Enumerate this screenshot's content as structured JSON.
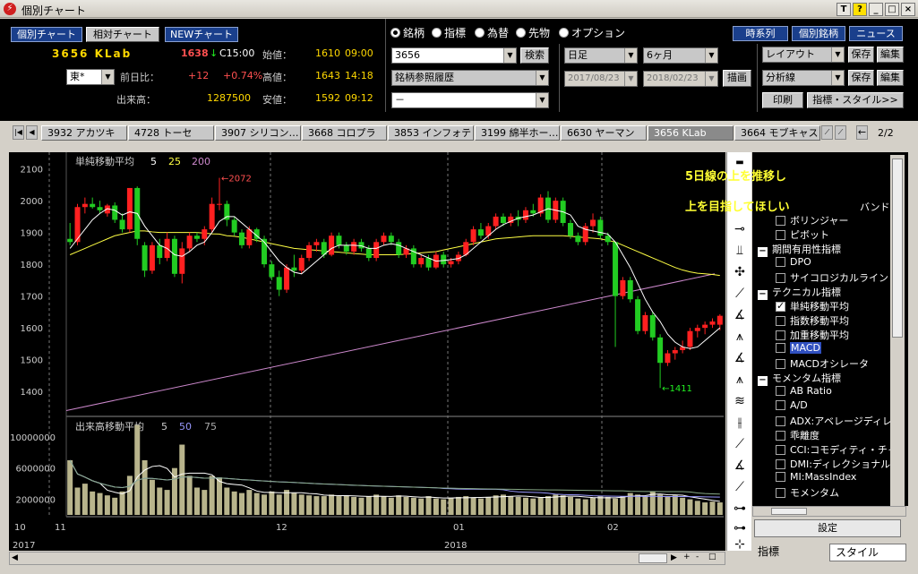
{
  "window": {
    "title": "個別チャート",
    "controls": [
      "T",
      "?",
      "_",
      "□",
      "×"
    ]
  },
  "header": {
    "view_buttons": [
      "個別チャート",
      "相対チャート",
      "NEWチャート"
    ],
    "stock": {
      "code_name": "3656 KLab",
      "price": "1638",
      "arrow": "↓",
      "time": "C15:00",
      "open_label": "始値：",
      "open": "1610",
      "open_time": "09:00",
      "change_label": "前日比：",
      "change": "+12",
      "change_pct": "+0.74%",
      "high_label": "高値：",
      "high": "1643",
      "high_time": "14:18",
      "volume_label": "出来高：",
      "volume": "1287500",
      "low_label": "安値：",
      "low": "1592",
      "low_time": "09:12",
      "market": "東*"
    },
    "radios": [
      {
        "label": "銘柄",
        "on": true
      },
      {
        "label": "指標",
        "on": false
      },
      {
        "label": "為替",
        "on": false
      },
      {
        "label": "先物",
        "on": false
      },
      {
        "label": "オプション",
        "on": false
      }
    ],
    "code_input": "3656",
    "search_button": "検索",
    "history_select": "銘柄参照履歴",
    "empty_select": "－",
    "period_select": "日足",
    "range_select": "6ヶ月",
    "date_from": "2017/08/23",
    "date_to": "2018/02/23",
    "draw_button": "描画",
    "right_buttons": [
      "時系列",
      "個別銘柄",
      "ニュース"
    ],
    "layout_select": "レイアウト",
    "analysis_select": "分析線",
    "save_label": "保存",
    "edit_label": "編集",
    "print_button": "印刷",
    "style_button": "指標・スタイル>>"
  },
  "tabs": {
    "items": [
      "3932 アカツキ",
      "4728 トーセ",
      "3907 シリコン…",
      "3668 コロプラ",
      "3853 インフォテリ",
      "3199 綿半ホー…",
      "6630 ヤーマン",
      "3656 KLab",
      "3664 モブキャス"
    ],
    "active_index": 7,
    "page": "2/2"
  },
  "chart": {
    "price_legend": {
      "label": "単純移動平均",
      "p1": "5",
      "p2": "25",
      "p3": "200"
    },
    "volume_legend": {
      "label": "出来高移動平均",
      "p1": "5",
      "p2": "50",
      "p3": "75"
    },
    "high_annot": "←2072",
    "low_annot": "←1411",
    "annotation_line1": "5日線の上を推移し",
    "annotation_line2": "上を目指してほしい",
    "price_ticks": [
      "2100",
      "2000",
      "1900",
      "1800",
      "1700",
      "1600",
      "1500",
      "1400"
    ],
    "volume_ticks": [
      "10000000",
      "6000000",
      "2000000"
    ],
    "x_labels": [
      "10",
      "11",
      "12",
      "01",
      "02"
    ],
    "year_labels": [
      "2017",
      "2018"
    ],
    "colors": {
      "up": "#ff2020",
      "down": "#22cc22",
      "ma5": "#ffffff",
      "ma25": "#ffff44",
      "ma200": "#cc88cc",
      "vol": "#b8b48c"
    }
  },
  "chart_data": {
    "type": "candlestick",
    "title": "",
    "ylim": [
      1330,
      2130
    ],
    "candles": [
      [
        1880,
        1930,
        1860,
        1870
      ],
      [
        1870,
        1990,
        1860,
        1980
      ],
      [
        1980,
        2010,
        1960,
        1990
      ],
      [
        1990,
        2010,
        1975,
        1980
      ],
      [
        1980,
        2000,
        1960,
        1970
      ],
      [
        1960,
        1990,
        1950,
        1985
      ],
      [
        1985,
        1995,
        1930,
        1940
      ],
      [
        1940,
        1960,
        1900,
        1910
      ],
      [
        1910,
        2040,
        1900,
        2040
      ],
      [
        2040,
        2045,
        1860,
        1880
      ],
      [
        1860,
        1870,
        1760,
        1780
      ],
      [
        1780,
        1870,
        1770,
        1860
      ],
      [
        1860,
        1880,
        1800,
        1820
      ],
      [
        1820,
        1900,
        1810,
        1880
      ],
      [
        1880,
        1890,
        1760,
        1770
      ],
      [
        1770,
        1870,
        1740,
        1850
      ],
      [
        1850,
        1900,
        1840,
        1890
      ],
      [
        1890,
        1900,
        1870,
        1880
      ],
      [
        1880,
        1920,
        1860,
        1910
      ],
      [
        1910,
        2010,
        1900,
        1990
      ],
      [
        1990,
        2072,
        1970,
        1990
      ],
      [
        1990,
        2000,
        1920,
        1940
      ],
      [
        1940,
        1950,
        1890,
        1900
      ],
      [
        1900,
        1910,
        1850,
        1860
      ],
      [
        1860,
        1920,
        1850,
        1910
      ],
      [
        1910,
        1915,
        1870,
        1880
      ],
      [
        1880,
        1890,
        1790,
        1800
      ],
      [
        1800,
        1810,
        1750,
        1760
      ],
      [
        1760,
        1780,
        1700,
        1720
      ],
      [
        1720,
        1800,
        1710,
        1790
      ],
      [
        1790,
        1830,
        1760,
        1780
      ],
      [
        1780,
        1830,
        1770,
        1820
      ],
      [
        1820,
        1870,
        1810,
        1860
      ],
      [
        1860,
        1880,
        1840,
        1870
      ],
      [
        1870,
        1880,
        1820,
        1830
      ],
      [
        1830,
        1900,
        1825,
        1890
      ],
      [
        1890,
        1900,
        1850,
        1860
      ],
      [
        1860,
        1870,
        1830,
        1840
      ],
      [
        1840,
        1880,
        1830,
        1870
      ],
      [
        1870,
        1880,
        1840,
        1850
      ],
      [
        1850,
        1860,
        1810,
        1820
      ],
      [
        1820,
        1880,
        1810,
        1870
      ],
      [
        1870,
        1900,
        1860,
        1890
      ],
      [
        1890,
        1900,
        1860,
        1870
      ],
      [
        1870,
        1880,
        1820,
        1830
      ],
      [
        1830,
        1860,
        1820,
        1850
      ],
      [
        1850,
        1860,
        1790,
        1800
      ],
      [
        1800,
        1830,
        1790,
        1820
      ],
      [
        1820,
        1830,
        1780,
        1790
      ],
      [
        1790,
        1840,
        1785,
        1830
      ],
      [
        1830,
        1840,
        1790,
        1800
      ],
      [
        1800,
        1820,
        1790,
        1810
      ],
      [
        1810,
        1840,
        1800,
        1830
      ],
      [
        1830,
        1880,
        1825,
        1870
      ],
      [
        1870,
        1920,
        1860,
        1910
      ],
      [
        1910,
        1930,
        1880,
        1890
      ],
      [
        1890,
        1930,
        1880,
        1920
      ],
      [
        1920,
        1960,
        1910,
        1950
      ],
      [
        1950,
        1960,
        1920,
        1930
      ],
      [
        1930,
        1960,
        1920,
        1950
      ],
      [
        1950,
        1970,
        1920,
        1940
      ],
      [
        1940,
        1980,
        1930,
        1970
      ],
      [
        1970,
        1990,
        1950,
        1960
      ],
      [
        1960,
        2020,
        1950,
        2010
      ],
      [
        2010,
        2030,
        1930,
        1940
      ],
      [
        1940,
        2010,
        1930,
        2000
      ],
      [
        2000,
        2010,
        1920,
        1930
      ],
      [
        1930,
        1940,
        1880,
        1890
      ],
      [
        1890,
        1900,
        1860,
        1870
      ],
      [
        1870,
        1930,
        1860,
        1920
      ],
      [
        1920,
        1960,
        1900,
        1940
      ],
      [
        1940,
        1950,
        1880,
        1890
      ],
      [
        1890,
        1900,
        1860,
        1870
      ],
      [
        1870,
        1700,
        1540,
        1700
      ],
      [
        1700,
        1760,
        1690,
        1750
      ],
      [
        1750,
        1760,
        1680,
        1690
      ],
      [
        1690,
        1700,
        1580,
        1590
      ],
      [
        1590,
        1650,
        1580,
        1640
      ],
      [
        1640,
        1650,
        1560,
        1570
      ],
      [
        1570,
        1580,
        1411,
        1490
      ],
      [
        1490,
        1530,
        1480,
        1520
      ],
      [
        1520,
        1540,
        1500,
        1530
      ],
      [
        1530,
        1560,
        1520,
        1540
      ],
      [
        1540,
        1600,
        1530,
        1590
      ],
      [
        1590,
        1610,
        1570,
        1600
      ],
      [
        1600,
        1620,
        1580,
        1610
      ],
      [
        1610,
        1630,
        1600,
        1620
      ],
      [
        1610,
        1643,
        1592,
        1638
      ]
    ],
    "ma5": [
      1850,
      1880,
      1910,
      1940,
      1960,
      1975,
      1970,
      1955,
      1965,
      1960,
      1920,
      1890,
      1860,
      1850,
      1830,
      1825,
      1840,
      1860,
      1870,
      1900,
      1935,
      1950,
      1950,
      1930,
      1910,
      1890,
      1870,
      1840,
      1810,
      1790,
      1775,
      1770,
      1790,
      1810,
      1830,
      1850,
      1860,
      1860,
      1860,
      1858,
      1850,
      1850,
      1860,
      1865,
      1860,
      1850,
      1840,
      1830,
      1820,
      1810,
      1812,
      1815,
      1818,
      1830,
      1850,
      1870,
      1890,
      1910,
      1925,
      1935,
      1945,
      1950,
      1955,
      1965,
      1975,
      1970,
      1965,
      1955,
      1920,
      1910,
      1905,
      1900,
      1895,
      1870,
      1830,
      1790,
      1740,
      1690,
      1650,
      1620,
      1580,
      1555,
      1540,
      1535,
      1540,
      1560,
      1580,
      1600
    ],
    "ma25": [
      1830,
      1840,
      1850,
      1860,
      1870,
      1880,
      1890,
      1895,
      1900,
      1905,
      1905,
      1902,
      1900,
      1900,
      1900,
      1900,
      1900,
      1900,
      1898,
      1896,
      1895,
      1890,
      1888,
      1885,
      1880,
      1875,
      1870,
      1865,
      1860,
      1855,
      1850,
      1848,
      1846,
      1844,
      1842,
      1840,
      1838,
      1836,
      1834,
      1832,
      1830,
      1830,
      1830,
      1830,
      1830,
      1832,
      1834,
      1836,
      1838,
      1840,
      1845,
      1850,
      1855,
      1860,
      1865,
      1870,
      1875,
      1880,
      1882,
      1884,
      1886,
      1888,
      1890,
      1890,
      1890,
      1890,
      1890,
      1888,
      1886,
      1884,
      1882,
      1880,
      1875,
      1870,
      1860,
      1850,
      1840,
      1830,
      1820,
      1810,
      1800,
      1790,
      1782,
      1776,
      1772,
      1770,
      1768,
      1765
    ],
    "ma200_start": 1340,
    "ma200_end": 1770,
    "volume": [
      7000000,
      3500000,
      4000000,
      3000000,
      2800000,
      2500000,
      2200000,
      3000000,
      5000000,
      11500000,
      7000000,
      4500000,
      3500000,
      3200000,
      6000000,
      9000000,
      5000000,
      3500000,
      3200000,
      5000000,
      4800000,
      3500000,
      3000000,
      2800000,
      3200000,
      2800000,
      2600000,
      3000000,
      2600000,
      3200000,
      2800000,
      2600000,
      2500000,
      2400000,
      2400000,
      2600000,
      2400000,
      2500000,
      2300000,
      2200000,
      2400000,
      2600000,
      2400000,
      2200000,
      2500000,
      2300000,
      2200000,
      2100000,
      2400000,
      2100000,
      2000000,
      2200000,
      2300000,
      2400000,
      2200000,
      2100000,
      2300000,
      2500000,
      2600000,
      2400000,
      2300000,
      2200000,
      2100000,
      2200000,
      2400000,
      2600000,
      2500000,
      2300000,
      2100000,
      2000000,
      2200000,
      2400000,
      2300000,
      2100000,
      2400000,
      2800000,
      2600000,
      2400000,
      3000000,
      2600000,
      2300000,
      2500000,
      2200000,
      2000000,
      1800000,
      1600000,
      1700000,
      1600000
    ],
    "volume_ylim": [
      0,
      12500000
    ]
  },
  "side_panel": {
    "items": [
      {
        "t": "ボリンジャー",
        "k": "chk",
        "on": false
      },
      {
        "t": "ピボット",
        "k": "chk",
        "on": false
      },
      {
        "t": "期間有用性指標",
        "k": "grp"
      },
      {
        "t": "DPO",
        "k": "chk",
        "on": false
      },
      {
        "t": "サイコロジカルライン",
        "k": "chk",
        "on": false
      },
      {
        "t": "テクニカル指標",
        "k": "grp"
      },
      {
        "t": "単純移動平均",
        "k": "chk",
        "on": true
      },
      {
        "t": "指数移動平均",
        "k": "chk",
        "on": false
      },
      {
        "t": "加重移動平均",
        "k": "chk",
        "on": false
      },
      {
        "t": "MACD",
        "k": "chk",
        "on": false,
        "sel": true
      },
      {
        "t": "MACDオシレータ",
        "k": "chk",
        "on": false
      },
      {
        "t": "モメンタム指標",
        "k": "grp"
      },
      {
        "t": "AB Ratio",
        "k": "chk",
        "on": false
      },
      {
        "t": "A/D",
        "k": "chk",
        "on": false
      },
      {
        "t": "ADX:アベレージディレ",
        "k": "chk",
        "on": false
      },
      {
        "t": "乖離度",
        "k": "chk",
        "on": false
      },
      {
        "t": "CCI:コモディティ・チャ",
        "k": "chk",
        "on": false
      },
      {
        "t": "DMI:ディレクショナル",
        "k": "chk",
        "on": false
      },
      {
        "t": "MI:MassIndex",
        "k": "chk",
        "on": false
      },
      {
        "t": "モメンタム",
        "k": "chk",
        "on": false
      }
    ],
    "band_label": "バンド",
    "settings_button": "設定",
    "tab_indicator": "指標",
    "tab_style": "スタイル"
  }
}
